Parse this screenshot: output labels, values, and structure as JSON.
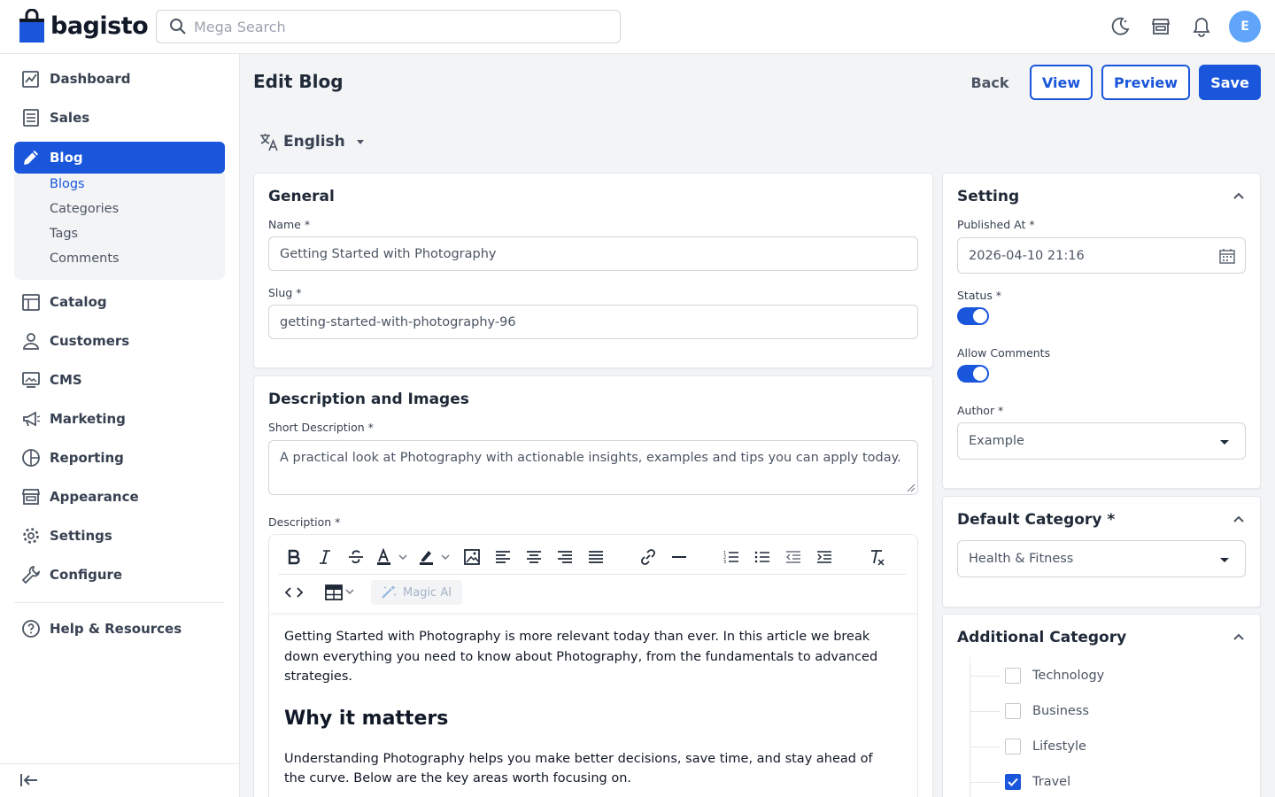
{
  "brand": {
    "name": "bagisto",
    "avatar_initial": "E"
  },
  "search": {
    "placeholder": "Mega Search"
  },
  "sidebar": {
    "items": [
      {
        "label": "Dashboard"
      },
      {
        "label": "Sales"
      },
      {
        "label": "Blog"
      },
      {
        "label": "Catalog"
      },
      {
        "label": "Customers"
      },
      {
        "label": "CMS"
      },
      {
        "label": "Marketing"
      },
      {
        "label": "Reporting"
      },
      {
        "label": "Appearance"
      },
      {
        "label": "Settings"
      },
      {
        "label": "Configure"
      },
      {
        "label": "Help & Resources"
      }
    ],
    "blog_sub": [
      "Blogs",
      "Categories",
      "Tags",
      "Comments"
    ]
  },
  "header": {
    "title": "Edit Blog",
    "back": "Back",
    "view": "View",
    "preview": "Preview",
    "save": "Save",
    "locale": "English"
  },
  "general": {
    "title": "General",
    "name_label": "Name *",
    "name_value": "Getting Started with Photography",
    "slug_label": "Slug *",
    "slug_value": "getting-started-with-photography-96"
  },
  "desc": {
    "title": "Description and Images",
    "short_label": "Short Description *",
    "short_value": "A practical look at Photography with actionable insights, examples and tips you can apply today.",
    "desc_label": "Description *",
    "magic_ai": "Magic AI",
    "p1": "Getting Started with Photography is more relevant today than ever. In this article we break down everything you need to know about Photography, from the fundamentals to advanced strategies.",
    "h2": "Why it matters",
    "p2": "Understanding Photography helps you make better decisions, save time, and stay ahead of the curve. Below are the key areas worth focusing on."
  },
  "setting": {
    "title": "Setting",
    "published_label": "Published At *",
    "published_value": "2026-04-10 21:16",
    "status_label": "Status *",
    "status_on": true,
    "comments_label": "Allow Comments",
    "comments_on": true,
    "author_label": "Author *",
    "author_value": "Example"
  },
  "default_category": {
    "title": "Default Category *",
    "value": "Health & Fitness"
  },
  "additional_category": {
    "title": "Additional Category",
    "items": [
      {
        "label": "Technology",
        "checked": false
      },
      {
        "label": "Business",
        "checked": false
      },
      {
        "label": "Lifestyle",
        "checked": false
      },
      {
        "label": "Travel",
        "checked": true
      }
    ]
  },
  "colors": {
    "primary": "#1a56db",
    "avatar": "#60a5fa"
  }
}
